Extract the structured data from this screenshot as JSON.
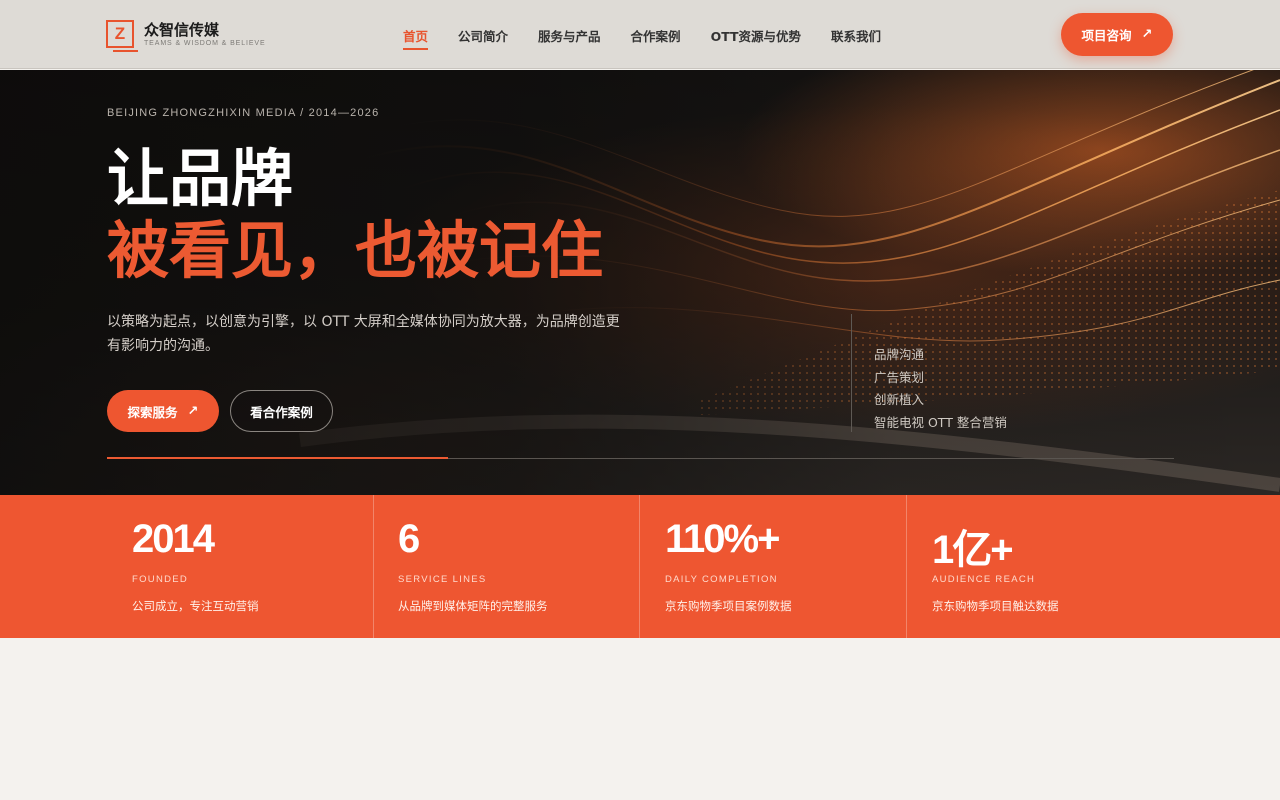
{
  "header": {
    "logo_mark": "Z",
    "logo_name": "众智信传媒",
    "logo_sub": "TEAMS & WISDOM & BELIEVE",
    "nav": [
      {
        "label": "首页",
        "active": true
      },
      {
        "label": "公司简介",
        "active": false
      },
      {
        "label": "服务与产品",
        "active": false
      },
      {
        "label": "合作案例",
        "active": false
      },
      {
        "label": "OTT资源与优势",
        "active": false
      },
      {
        "label": "联系我们",
        "active": false
      }
    ],
    "cta_label": "项目咨询",
    "cta_arrow": "↗"
  },
  "hero": {
    "kicker": "BEIJING ZHONGZHIXIN MEDIA / 2014—2026",
    "title_line1": "让品牌",
    "title_line2": "被看见，也被记住",
    "description": "以策略为起点，以创意为引擎，以 OTT 大屏和全媒体协同为放大器，为品牌创造更有影响力的沟通。",
    "primary_button": "探索服务",
    "primary_arrow": "↗",
    "secondary_button": "看合作案例",
    "services": [
      "品牌沟通",
      "广告策划",
      "创新植入",
      "智能电视 OTT 整合营销"
    ],
    "progress": 0.32
  },
  "stats": [
    {
      "value": "2014",
      "label": "FOUNDED",
      "desc": "公司成立，专注互动营销"
    },
    {
      "value": "6",
      "label": "SERVICE LINES",
      "desc": "从品牌到媒体矩阵的完整服务"
    },
    {
      "value": "110%+",
      "label": "DAILY COMPLETION",
      "desc": "京东购物季项目案例数据"
    },
    {
      "value": "1亿+",
      "label": "AUDIENCE REACH",
      "desc": "京东购物季项目触达数据"
    }
  ],
  "colors": {
    "accent": "#ee5630",
    "header_bg": "#dedbd6",
    "hero_bg": "#1c1917",
    "page_bg": "#f4f2ee"
  }
}
